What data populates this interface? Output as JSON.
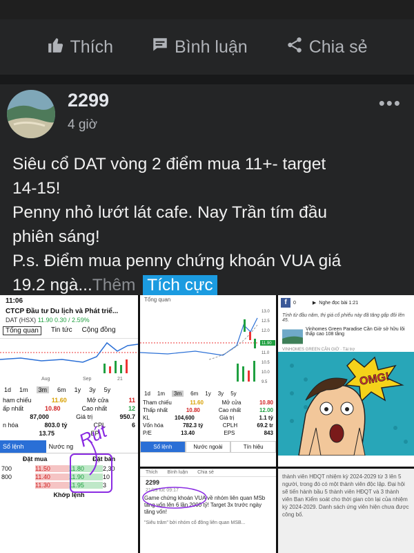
{
  "actions": {
    "like": "Thích",
    "comment": "Bình luận",
    "share": "Chia sẻ"
  },
  "post": {
    "author": "2299",
    "time": "4 giờ",
    "lines": [
      "Siêu cổ DAT vòng 2 điểm mua 11+- target",
      "14-15!",
      "Penny nhỏ lướt lát cafe. Nay Trần tím đầu",
      "phiên sáng!",
      "P.s. Điểm mua penny chứng khoán VUA giá"
    ],
    "last_line": "19.2 ngà...",
    "see_more": "Thêm",
    "sentiment_tag": "Tích cực"
  },
  "img1": {
    "status_time": "11:06",
    "title": "CTCP Đầu tư Du lịch và Phát triể...",
    "ticker_line": "DAT (HSX)",
    "ticker_price": "11.90 0.30 / 2.59%",
    "tabs": [
      "Tổng quan",
      "Tin tức",
      "Cộng đồng"
    ],
    "axis": [
      "Aug",
      "Sep",
      "21"
    ],
    "ranges": [
      "1d",
      "1m",
      "3m",
      "6m",
      "1y",
      "3y",
      "5y"
    ],
    "stats": [
      {
        "label": "ham chiếu",
        "v1": "11.60",
        "label2": "Mở cửa",
        "v2": "11"
      },
      {
        "label": "ấp nhất",
        "v1": "10.80",
        "label2": "Cao nhất",
        "v2": "12"
      },
      {
        "label": "",
        "v1": "87,000",
        "label2": "Giá trị",
        "v2": "950.7"
      },
      {
        "label": "n hóa",
        "v1": "803.0 tỷ",
        "label2": "CPL",
        "v2": "6"
      },
      {
        "label": "",
        "v1": "13.75",
        "label2": "EP",
        "v2": ""
      }
    ],
    "order_tabs": [
      "Sổ lệnh",
      "Nước ng",
      ""
    ],
    "book_headers": [
      "Đặt mua",
      "Đặt bán"
    ],
    "book_rows": [
      {
        "vol": "700",
        "buy": "11.50",
        "sell": "11.80",
        "svol": "2,30"
      },
      {
        "vol": "800",
        "buy": "11.40",
        "sell": "11.90",
        "svol": "10"
      },
      {
        "vol": "",
        "buy": "11.30",
        "sell": "11.95",
        "svol": "3"
      }
    ],
    "match": "Khớp lệnh",
    "handwriting": "Rút"
  },
  "img2": {
    "tab": "Tổng quan",
    "price_tags": [
      "13.0",
      "12.5",
      "12.0",
      "11.5",
      "11.0",
      "10.5",
      "10.0",
      "9.5"
    ],
    "current": "11.90",
    "ranges": [
      "1d",
      "1m",
      "3m",
      "6m",
      "1y",
      "3y",
      "5y"
    ],
    "stats": [
      {
        "a": "Tham chiếu",
        "b": "11.60",
        "c": "Mở cửa",
        "d": "10.80"
      },
      {
        "a": "Thấp nhất",
        "b": "10.80",
        "c": "Cao nhất",
        "d": "12.00"
      },
      {
        "a": "KL",
        "b": "104,600",
        "c": "Giá trị",
        "d": "1.1 tỷ"
      },
      {
        "a": "Vốn hóa",
        "b": "782.3 tỷ",
        "c": "CPLH",
        "d": "69.2 tr"
      },
      {
        "a": "P/E",
        "b": "13.40",
        "c": "EPS",
        "d": "843"
      }
    ],
    "tabs": [
      "Sổ lệnh",
      "Nước ngoài",
      "Tín hiệu"
    ]
  },
  "img3": {
    "count": "0",
    "audio": "Nghe đọc bài 1:21",
    "intro": "Tính từ đầu năm, thị giá cổ phiếu này đã tăng gấp đôi lên 45.",
    "ad_title": "Vinhomes Green Paradise Cần Giờ sở hữu lõi thấp cao 108 tầng",
    "ad_src": "VINHOMES GREEN CÂN GIỜ · Tài trợ",
    "omg": "OMG!"
  },
  "img4": {
    "like": "Thích",
    "comment": "Bình luận",
    "share": "Chia sẻ",
    "author": "2299",
    "when": "21/09 lúc 09:17",
    "text": "Game chứng khoán VUA về nhóm liên quan MSb tăng vốn lên 6 lần 2000 tỷ! Target 3x trước ngày tăng vốn!",
    "quote": "\"Siêu trâm\" bởi nhóm cổ đông liên quan MSB..."
  },
  "img5": {
    "text": "thành viên HĐQT nhiệm kỳ 2024-2029 từ 3 lên 5 người, trong đó có một thành viên độc lập. Đại hội sẽ tiến hành bầu 5 thành viên HĐQT và 3 thành viên Ban Kiểm soát cho thời gian còn lại của nhiệm kỳ 2024-2029. Danh sách ứng viên hiện chưa được công bố."
  },
  "colors": {
    "background": "#242526",
    "separator": "#18191a",
    "text": "#e4e6eb",
    "muted": "#b0b3b8",
    "tag": "#1b9be0"
  }
}
